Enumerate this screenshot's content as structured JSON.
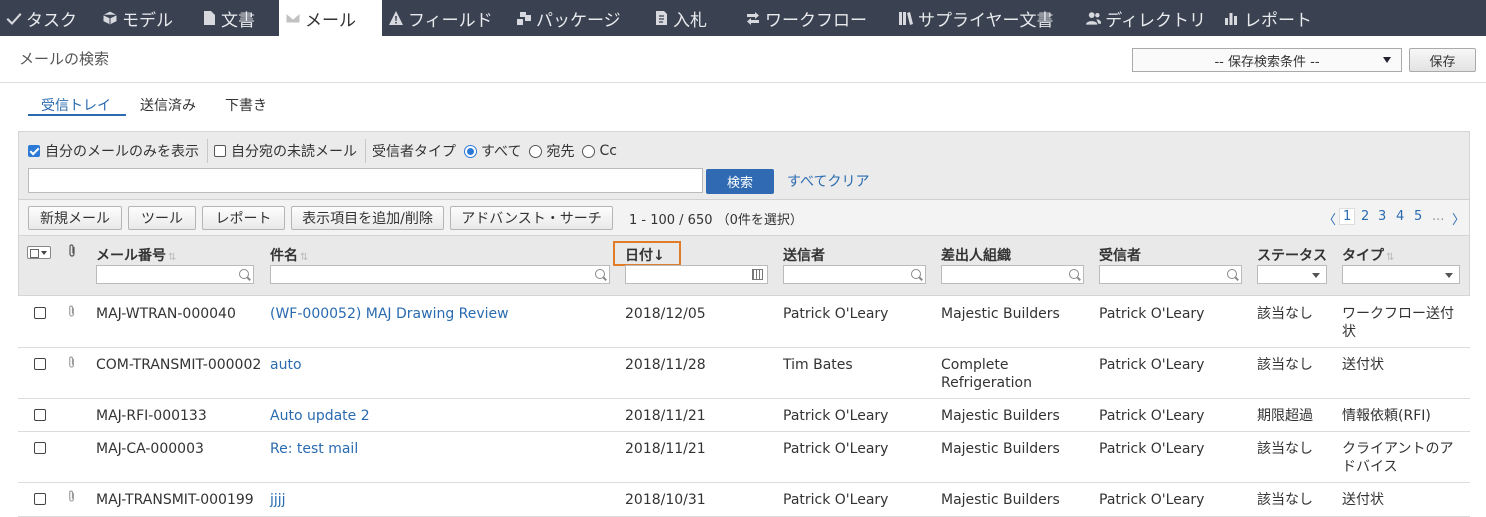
{
  "nav": {
    "items": [
      {
        "label": "タスク",
        "icon": "check-icon"
      },
      {
        "label": "モデル",
        "icon": "cube-icon"
      },
      {
        "label": "文書",
        "icon": "document-icon"
      },
      {
        "label": "メール",
        "icon": "envelope-icon",
        "active": true
      },
      {
        "label": "フィールド",
        "icon": "warning-icon"
      },
      {
        "label": "パッケージ",
        "icon": "package-icon"
      },
      {
        "label": "入札",
        "icon": "bid-icon"
      },
      {
        "label": "ワークフロー",
        "icon": "workflow-icon"
      },
      {
        "label": "サプライヤー文書",
        "icon": "books-icon"
      },
      {
        "label": "ディレクトリ",
        "icon": "people-icon"
      },
      {
        "label": "レポート",
        "icon": "bar-chart-icon"
      }
    ]
  },
  "header": {
    "title": "メールの検索",
    "saved_search": "-- 保存検索条件 --",
    "save_label": "保存"
  },
  "subtabs": {
    "inbox": "受信トレイ",
    "sent": "送信済み",
    "drafts": "下書き"
  },
  "filters": {
    "only_mine": "自分のメールのみを表示",
    "unread_to_me": "自分宛の未読メール",
    "recipient_type_label": "受信者タイプ",
    "all": "すべて",
    "to": "宛先",
    "cc": "Cc",
    "search_value": "",
    "search_button": "検索",
    "clear_all": "すべてクリア"
  },
  "toolbar": {
    "new_mail": "新規メール",
    "tools": "ツール",
    "report": "レポート",
    "add_remove_columns": "表示項目を追加/削除",
    "advanced_search": "アドバンスト・サーチ",
    "count": "1 - 100 / 650 （0件を選択）",
    "pager": {
      "prev": "〈",
      "pages": [
        "1",
        "2",
        "3",
        "4",
        "5"
      ],
      "ellipsis": "...",
      "next": "〉"
    }
  },
  "columns": {
    "mail_number": "メール番号",
    "subject": "件名",
    "date": "日付↓",
    "sender": "送信者",
    "sender_org": "差出人組織",
    "recipient": "受信者",
    "status": "ステータス",
    "type": "タイプ"
  },
  "rows": [
    {
      "has_attachment": true,
      "number": "MAJ-WTRAN-000040",
      "subject": "(WF-000052) MAJ Drawing Review",
      "date": "2018/12/05",
      "sender": "Patrick O'Leary",
      "org": "Majestic Builders",
      "recipient": "Patrick O'Leary",
      "status": "該当なし",
      "type": "ワークフロー送付状"
    },
    {
      "has_attachment": true,
      "number": "COM-TRANSMIT-000002",
      "subject": "auto",
      "date": "2018/11/28",
      "sender": "Tim Bates",
      "org": "Complete Refrigeration",
      "recipient": "Patrick O'Leary",
      "status": "該当なし",
      "type": "送付状"
    },
    {
      "has_attachment": false,
      "number": "MAJ-RFI-000133",
      "subject": "Auto update 2",
      "date": "2018/11/21",
      "sender": "Patrick O'Leary",
      "org": "Majestic Builders",
      "recipient": "Patrick O'Leary",
      "status": "期限超過",
      "type": "情報依頼(RFI)"
    },
    {
      "has_attachment": false,
      "number": "MAJ-CA-000003",
      "subject": "Re: test mail",
      "date": "2018/11/21",
      "sender": "Patrick O'Leary",
      "org": "Majestic Builders",
      "recipient": "Patrick O'Leary",
      "status": "該当なし",
      "type": "クライアントのアドバイス"
    },
    {
      "has_attachment": true,
      "number": "MAJ-TRANSMIT-000199",
      "subject": "jjjj",
      "date": "2018/10/31",
      "sender": "Patrick O'Leary",
      "org": "Majestic Builders",
      "recipient": "Patrick O'Leary",
      "status": "該当なし",
      "type": "送付状"
    }
  ],
  "colors": {
    "nav_bg": "#3a4150",
    "accent": "#2a6bb0",
    "search_button": "#2f6ab2",
    "highlight": "#e07b2a"
  }
}
